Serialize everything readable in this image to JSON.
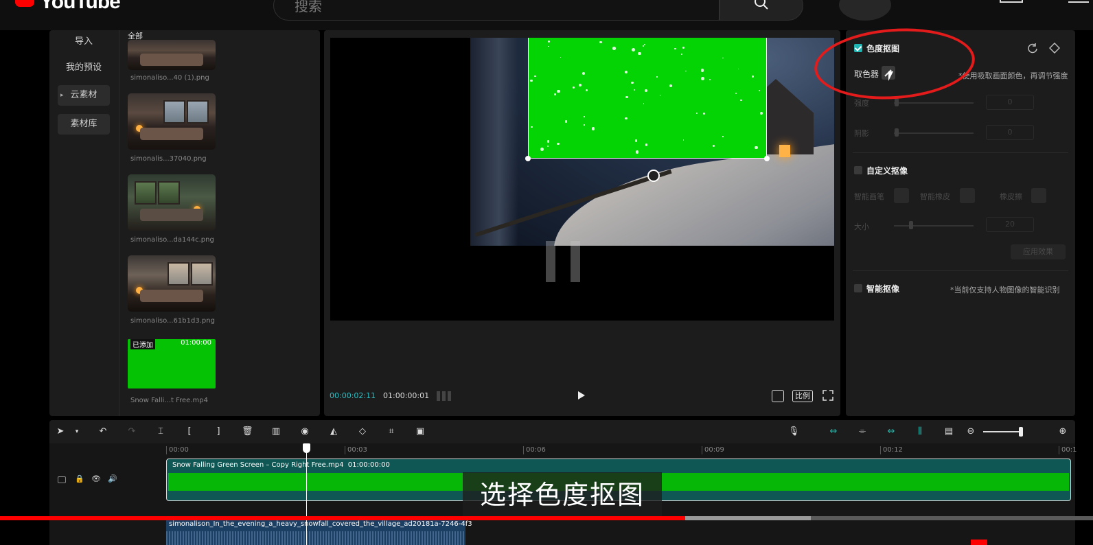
{
  "youtube": {
    "logo": "YouTube",
    "search_placeholder": "搜索",
    "progress_played_fraction": 0.627,
    "progress_buffered_fraction": 0.742
  },
  "media": {
    "nav": [
      {
        "label": "导入",
        "active": false
      },
      {
        "label": "我的预设",
        "active": false
      },
      {
        "label": "云素材",
        "active": true
      },
      {
        "label": "素材库",
        "active": true
      }
    ],
    "filter_label": "全部",
    "items": [
      {
        "name": "simonaliso...40 (1).png",
        "kind": "room"
      },
      {
        "name": "simonalis...37040.png",
        "kind": "room"
      },
      {
        "name": "simonaliso...da144c.png",
        "kind": "room"
      },
      {
        "name": "simonaliso...61b1d3.png",
        "kind": "room"
      },
      {
        "name": "Snow Falli...t Free.mp4",
        "kind": "green",
        "added_tag": "已添加",
        "duration": "01:00:00"
      }
    ]
  },
  "preview": {
    "current_time": "00:00:02:11",
    "total_time": "01:00:00:01",
    "ratio_label": "比例"
  },
  "properties": {
    "chroma": {
      "title": "色度抠图",
      "enabled": true
    },
    "picker": {
      "label": "取色器",
      "hint": "*使用吸取画面颜色，再调节强度"
    },
    "strength": {
      "label": "强度",
      "value": "0"
    },
    "shadow": {
      "label": "阴影",
      "value": "0"
    },
    "custom": {
      "title": "自定义抠像",
      "enabled": false
    },
    "brush": {
      "smart": "智能画笔",
      "smart_eraser": "智能橡皮",
      "eraser": "橡皮擦"
    },
    "size": {
      "label": "大小",
      "value": "20"
    },
    "apply_label": "应用效果",
    "smart_cutout": {
      "title": "智能抠像",
      "hint": "*当前仅支持人物图像的智能识别",
      "enabled": false
    }
  },
  "timeline": {
    "ruler": [
      "00:00",
      "00:03",
      "00:06",
      "00:09",
      "00:12",
      "00:1"
    ],
    "main_clip": {
      "name": "Snow Falling Green Screen – Copy Right Free.mp4",
      "duration": "01:00:00:00"
    },
    "second_clip": {
      "name": "simonalison_In_the_evening_a_heavy_snowfall_covered_the_village_ad20181a-7246-4f3"
    }
  },
  "subtitle": "选择色度抠图",
  "colors": {
    "accent_teal": "#1fb5b2",
    "green_screen": "#04d404",
    "annotation_red": "#e31b1b",
    "youtube_red": "#ff0000"
  }
}
